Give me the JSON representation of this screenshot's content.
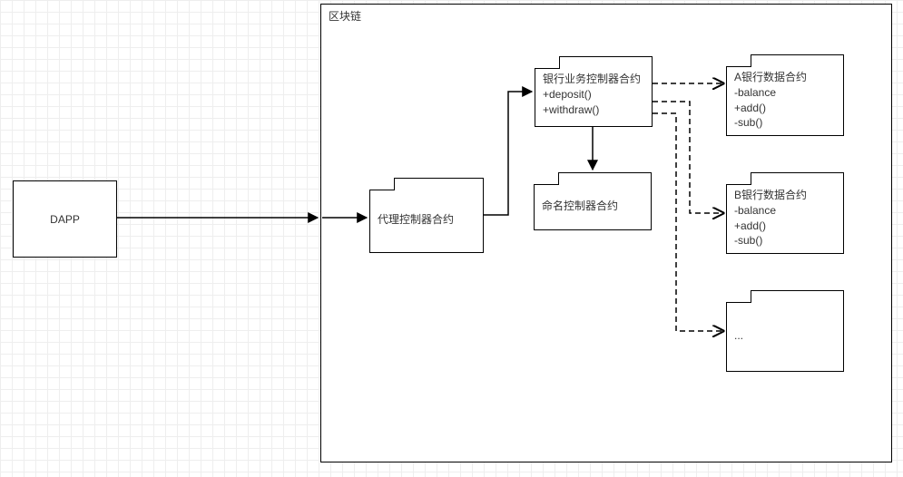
{
  "diagram": {
    "container_label": "区块链",
    "dapp": "DAPP",
    "proxy": {
      "line1": "代理控制器合约"
    },
    "bank_ctrl": {
      "line1": "银行业务控制器合约",
      "line2": "+deposit()",
      "line3": "+withdraw()"
    },
    "naming": {
      "line1": "命名控制器合约"
    },
    "bankA": {
      "line1": "A银行数据合约",
      "line2": "-balance",
      "line3": "+add()",
      "line4": "-sub()"
    },
    "bankB": {
      "line1": "B银行数据合约",
      "line2": "-balance",
      "line3": "+add()",
      "line4": "-sub()"
    },
    "more": {
      "line1": "..."
    }
  }
}
